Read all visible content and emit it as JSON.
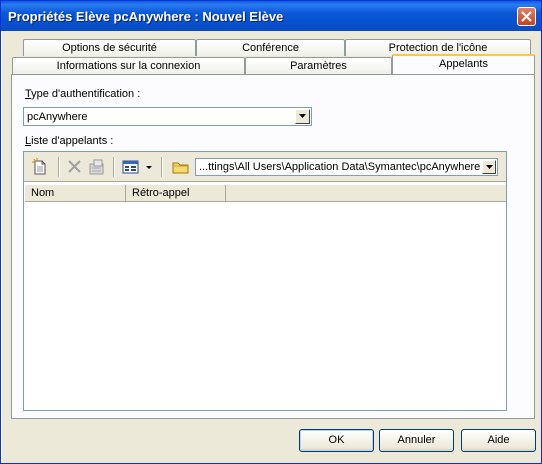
{
  "window": {
    "title": "Propriétés Elève pcAnywhere : Nouvel Elève"
  },
  "tabs": {
    "row1": [
      "Options de sécurité",
      "Conférence",
      "Protection de l'icône"
    ],
    "row2": [
      "Informations sur la connexion",
      "Paramètres",
      "Appelants"
    ],
    "active": "Appelants"
  },
  "auth": {
    "label_accel": "T",
    "label_rest": "ype d'authentification :",
    "value": "pcAnywhere"
  },
  "callers": {
    "label_accel": "L",
    "label_rest": "iste d'appelants :",
    "path": "...ttings\\All Users\\Application Data\\Symantec\\pcAnywhere",
    "columns": [
      "Nom",
      "Rétro-appel"
    ]
  },
  "toolbar": {
    "icons": [
      "new-item-icon",
      "delete-icon",
      "properties-icon",
      "view-icon",
      "dropdown-arrow-icon",
      "folder-icon"
    ]
  },
  "buttons": {
    "ok": "OK",
    "cancel": "Annuler",
    "help": "Aide"
  }
}
